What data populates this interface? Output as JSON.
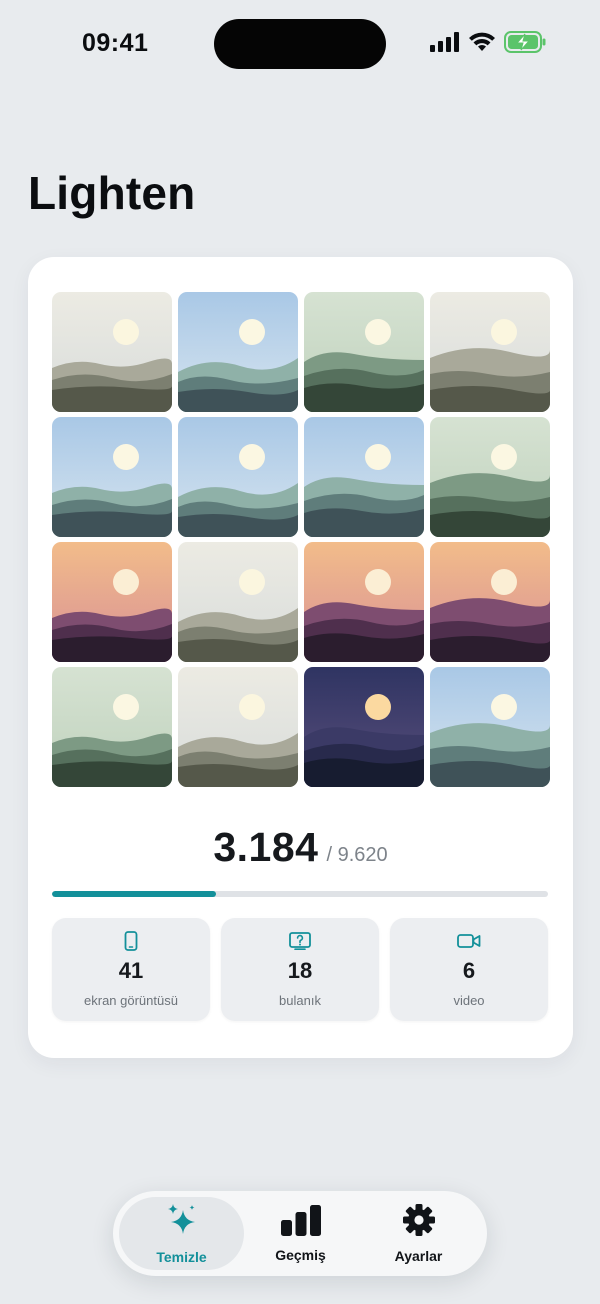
{
  "status_bar": {
    "time": "09:41"
  },
  "title": "Lighten",
  "progress": {
    "current": "3.184",
    "total": "/ 9.620",
    "fraction": 0.331
  },
  "stats": [
    {
      "icon": "phone-icon",
      "value": "41",
      "label": "ekran görüntüsü"
    },
    {
      "icon": "blur-question-icon",
      "value": "18",
      "label": "bulanık"
    },
    {
      "icon": "video-icon",
      "value": "6",
      "label": "video"
    }
  ],
  "tabs": [
    {
      "icon": "sparkle-icon",
      "label": "Temizle",
      "active": true
    },
    {
      "icon": "bar-chart-icon",
      "label": "Geçmiş",
      "active": false
    },
    {
      "icon": "gear-icon",
      "label": "Ayarlar",
      "active": false
    }
  ],
  "colors": {
    "accent": "#13909a",
    "background": "#e8ebee",
    "card": "#ffffff"
  },
  "photos": [
    {
      "theme": "mist"
    },
    {
      "theme": "blue"
    },
    {
      "theme": "green"
    },
    {
      "theme": "mist"
    },
    {
      "theme": "blue"
    },
    {
      "theme": "blue"
    },
    {
      "theme": "blue"
    },
    {
      "theme": "green"
    },
    {
      "theme": "sunset"
    },
    {
      "theme": "mist"
    },
    {
      "theme": "sunset"
    },
    {
      "theme": "sunset"
    },
    {
      "theme": "green"
    },
    {
      "theme": "mist"
    },
    {
      "theme": "night"
    },
    {
      "theme": "blue"
    }
  ]
}
